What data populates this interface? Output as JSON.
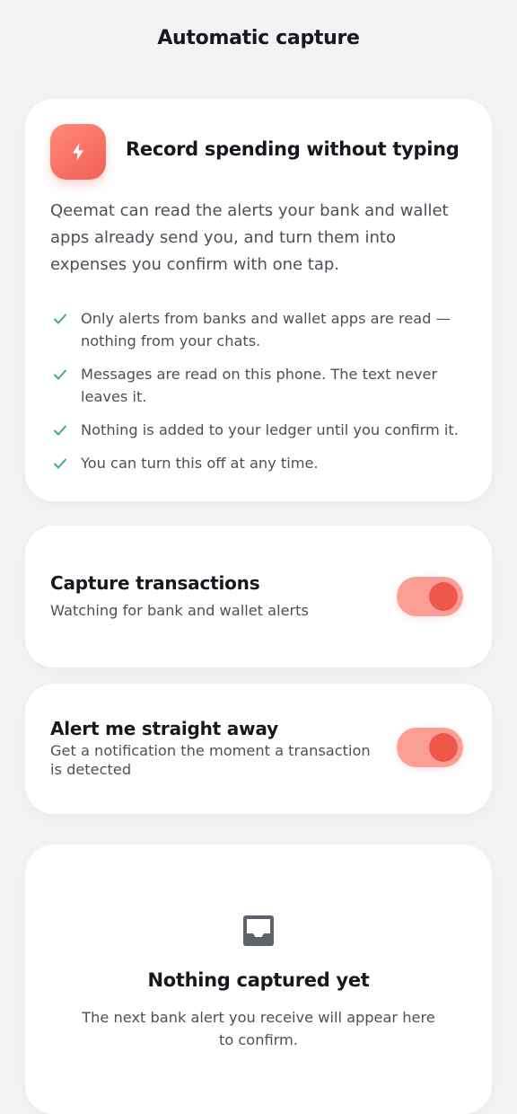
{
  "header": {
    "title": "Automatic capture"
  },
  "intro": {
    "icon": "lightning-bolt-icon",
    "title": "Record spending without typing",
    "description": "Qeemat can read the alerts your bank and wallet apps already send you, and turn them into expenses you confirm with one tap.",
    "points": [
      "Only alerts from banks and wallet apps are read — nothing from your chats.",
      "Messages are read on this phone. The text never leaves it.",
      "Nothing is added to your ledger until you confirm it.",
      "You can turn this off at any time."
    ]
  },
  "settings": {
    "capture": {
      "title": "Capture transactions",
      "subtitle": "Watching for bank and wallet alerts",
      "enabled": true
    },
    "alert": {
      "title": "Alert me straight away",
      "subtitle": "Get a notification the moment a transaction is detected",
      "enabled": true
    }
  },
  "empty_state": {
    "icon": "inbox-tray-icon",
    "title": "Nothing captured yet",
    "description": "The next bank alert you receive will appear here to confirm."
  },
  "colors": {
    "accent": "#f0574b",
    "accent_soft": "#fb9e96",
    "check": "#3fae72",
    "background": "#f3f3f5",
    "card": "#ffffff"
  }
}
